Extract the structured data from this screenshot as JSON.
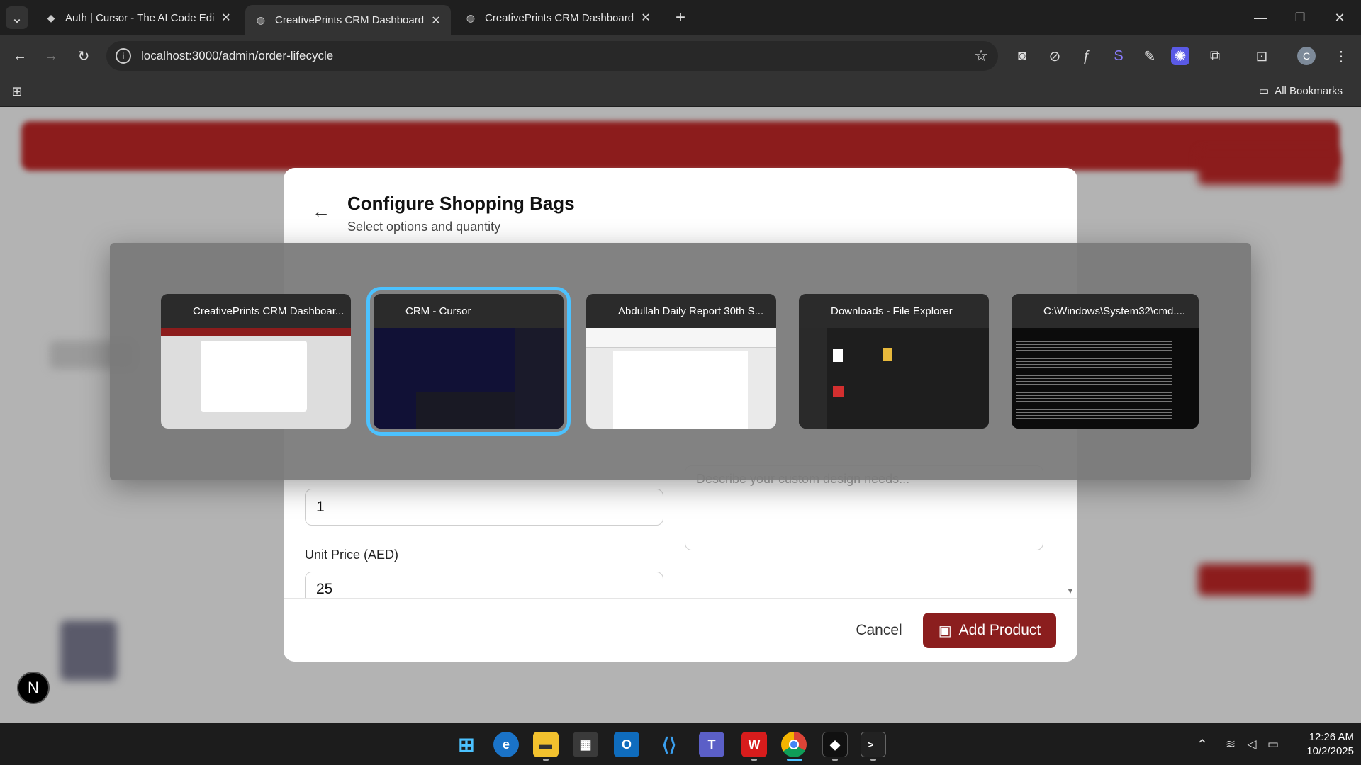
{
  "browser": {
    "tabs": [
      {
        "title": "Auth | Cursor - The AI Code Edi",
        "active": false,
        "icon": "cursor-icon"
      },
      {
        "title": "CreativePrints CRM Dashboard",
        "active": true,
        "icon": "globe-icon"
      },
      {
        "title": "CreativePrints CRM Dashboard",
        "active": false,
        "icon": "globe-icon"
      }
    ],
    "url": "localhost:3000/admin/order-lifecycle",
    "profile_initial": "C",
    "bookmarks_label": "All Bookmarks"
  },
  "modal": {
    "title": "Configure Shopping Bags",
    "subtitle": "Select options and quantity",
    "quantity_value": "1",
    "unit_price_label": "Unit Price (AED)",
    "unit_price_value": "25",
    "design_placeholder": "Describe your custom design needs...",
    "cancel_label": "Cancel",
    "add_label": "Add Product"
  },
  "switcher": {
    "windows": [
      {
        "title": "CreativePrints CRM Dashboar...",
        "app": "chrome-icon",
        "selected": false
      },
      {
        "title": "CRM - Cursor",
        "app": "cursor-icon",
        "selected": true
      },
      {
        "title": "Abdullah Daily Report 30th S...",
        "app": "wps-icon",
        "selected": false
      },
      {
        "title": "Downloads - File Explorer",
        "app": "folder-icon",
        "selected": false
      },
      {
        "title": "C:\\Windows\\System32\\cmd....",
        "app": "terminal-icon",
        "selected": false
      }
    ]
  },
  "badge": {
    "letter": "N"
  },
  "taskbar": {
    "time": "12:26 AM",
    "date": "10/2/2025"
  }
}
